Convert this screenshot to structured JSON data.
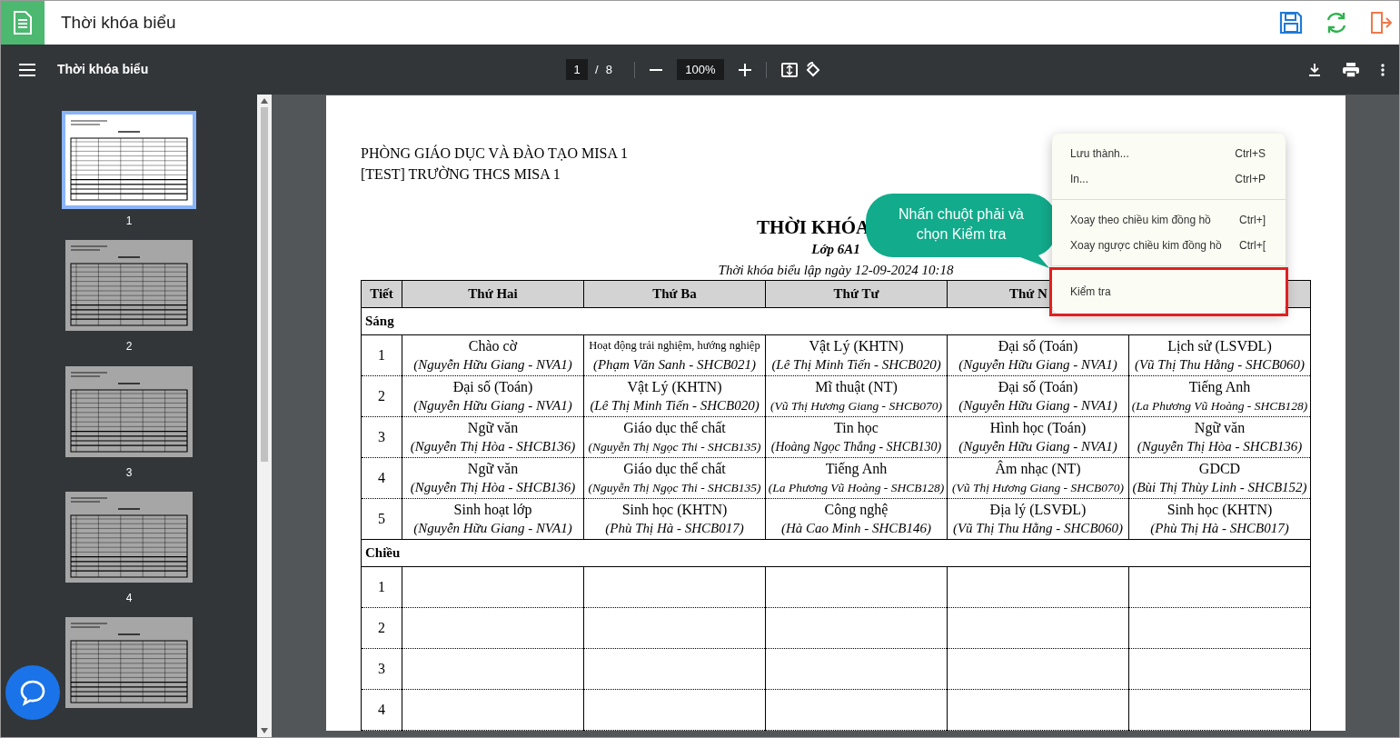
{
  "app": {
    "title": "Thời khóa biểu"
  },
  "toolbar": {
    "title": "Thời khóa biểu",
    "page": "1",
    "page_separator": "/",
    "page_total": "8",
    "zoom": "100%"
  },
  "thumbnails": [
    {
      "label": "1",
      "selected": true
    },
    {
      "label": "2",
      "selected": false
    },
    {
      "label": "3",
      "selected": false
    },
    {
      "label": "4",
      "selected": false
    },
    {
      "selected": false
    }
  ],
  "document": {
    "header_lines": [
      "PHÒNG GIÁO DỤC VÀ ĐÀO TẠO MISA 1",
      "[TEST] TRƯỜNG THCS MISA 1"
    ],
    "title": "THỜI KHÓA",
    "class_label": "Lớp 6A1",
    "created": "Thời khóa biểu lập ngày 12-09-2024 10:18",
    "columns": [
      "Tiết",
      "Thứ Hai",
      "Thứ Ba",
      "Thứ Tư",
      "Thứ N"
    ],
    "sections": [
      {
        "label": "Sáng",
        "rows": [
          {
            "period": "1",
            "cells": [
              {
                "subject": "Chào cờ",
                "teacher": "(Nguyễn Hữu Giang - NVA1)"
              },
              {
                "subject": "Hoạt động trải nghiệm, hướng nghiệp",
                "teacher": "(Phạm Văn Sanh - SHCB021)"
              },
              {
                "subject": "Vật Lý (KHTN)",
                "teacher": "(Lê Thị Minh Tiến - SHCB020)"
              },
              {
                "subject": "Đại số (Toán)",
                "teacher": "(Nguyễn Hữu Giang - NVA1)"
              },
              {
                "subject": "Lịch sử (LSVĐL)",
                "teacher": "(Vũ Thị Thu Hằng - SHCB060)"
              }
            ]
          },
          {
            "period": "2",
            "cells": [
              {
                "subject": "Đại số (Toán)",
                "teacher": "(Nguyễn Hữu Giang - NVA1)"
              },
              {
                "subject": "Vật Lý (KHTN)",
                "teacher": "(Lê Thị Minh Tiến - SHCB020)"
              },
              {
                "subject": "Mĩ thuật (NT)",
                "teacher": "(Vũ Thị Hương Giang - SHCB070)"
              },
              {
                "subject": "Đại số (Toán)",
                "teacher": "(Nguyễn Hữu Giang - NVA1)"
              },
              {
                "subject": "Tiếng Anh",
                "teacher": "(La Phương Vũ Hoàng - SHCB128)"
              }
            ]
          },
          {
            "period": "3",
            "cells": [
              {
                "subject": "Ngữ văn",
                "teacher": "(Nguyễn Thị Hòa - SHCB136)"
              },
              {
                "subject": "Giáo dục thể chất",
                "teacher": "(Nguyễn Thị Ngọc Thi - SHCB135)"
              },
              {
                "subject": "Tin học",
                "teacher": "(Hoàng Ngọc Thắng - SHCB130)"
              },
              {
                "subject": "Hình học (Toán)",
                "teacher": "(Nguyễn Hữu Giang - NVA1)"
              },
              {
                "subject": "Ngữ văn",
                "teacher": "(Nguyễn Thị Hòa - SHCB136)"
              }
            ]
          },
          {
            "period": "4",
            "cells": [
              {
                "subject": "Ngữ văn",
                "teacher": "(Nguyễn Thị Hòa - SHCB136)"
              },
              {
                "subject": "Giáo dục thể chất",
                "teacher": "(Nguyễn Thị Ngọc Thi - SHCB135)"
              },
              {
                "subject": "Tiếng Anh",
                "teacher": "(La Phương Vũ Hoàng - SHCB128)"
              },
              {
                "subject": "Âm nhạc (NT)",
                "teacher": "(Vũ Thị Hương Giang - SHCB070)"
              },
              {
                "subject": "GDCD",
                "teacher": "(Bùi Thị Thùy Linh - SHCB152)"
              }
            ]
          },
          {
            "period": "5",
            "cells": [
              {
                "subject": "Sinh hoạt lớp",
                "teacher": "(Nguyễn Hữu Giang - NVA1)"
              },
              {
                "subject": "Sinh học (KHTN)",
                "teacher": "(Phù Thị Hà - SHCB017)"
              },
              {
                "subject": "Công nghệ",
                "teacher": "(Hà Cao Minh - SHCB146)"
              },
              {
                "subject": "Địa lý (LSVĐL)",
                "teacher": "(Vũ Thị Thu Hằng - SHCB060)"
              },
              {
                "subject": "Sinh học (KHTN)",
                "teacher": "(Phù Thị Hà - SHCB017)"
              }
            ]
          }
        ]
      },
      {
        "label": "Chiều",
        "rows": [
          {
            "period": "1"
          },
          {
            "period": "2"
          },
          {
            "period": "3"
          },
          {
            "period": "4"
          }
        ]
      }
    ]
  },
  "context_menu": {
    "groups": [
      [
        {
          "label": "Lưu thành...",
          "shortcut": "Ctrl+S",
          "highlighted": false
        },
        {
          "label": "In...",
          "shortcut": "Ctrl+P",
          "highlighted": false
        }
      ],
      [
        {
          "label": "Xoay theo chiều kim đồng hồ",
          "shortcut": "Ctrl+]",
          "highlighted": false
        },
        {
          "label": "Xoay ngược chiều kim đồng hồ",
          "shortcut": "Ctrl+[",
          "highlighted": false
        }
      ],
      [
        {
          "label": "Kiểm tra",
          "highlighted": true
        }
      ]
    ]
  },
  "callout": {
    "text": "Nhấn chuột phải và chọn Kiểm tra"
  }
}
